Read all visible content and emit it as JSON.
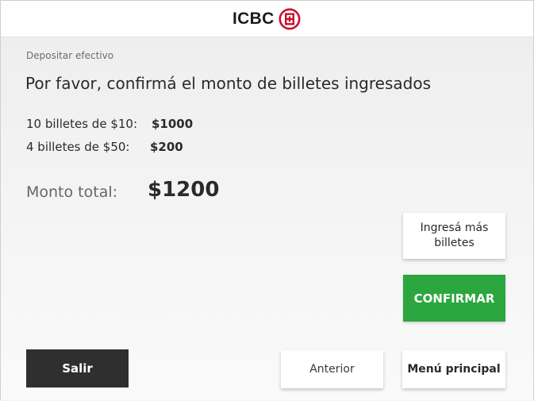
{
  "header": {
    "logo_text": "ICBC",
    "logo_icon": "icbc-emblem-icon",
    "brand_color": "#c8102e"
  },
  "breadcrumb": "Depositar efectivo",
  "title": "Por favor, confirmá el monto de billetes ingresados",
  "bills": [
    {
      "label": "10 billetes de $10:",
      "value": "$1000"
    },
    {
      "label": "4 billetes de $50:",
      "value": "$200"
    }
  ],
  "total": {
    "label": "Monto total:",
    "value": "$1200"
  },
  "actions": {
    "more_bills_label": "Ingresá más billetes",
    "confirm_label": "CONFIRMAR",
    "confirm_color": "#2ca63e"
  },
  "footer": {
    "exit_label": "Salir",
    "previous_label": "Anterior",
    "main_menu_label": "Menú principal"
  }
}
